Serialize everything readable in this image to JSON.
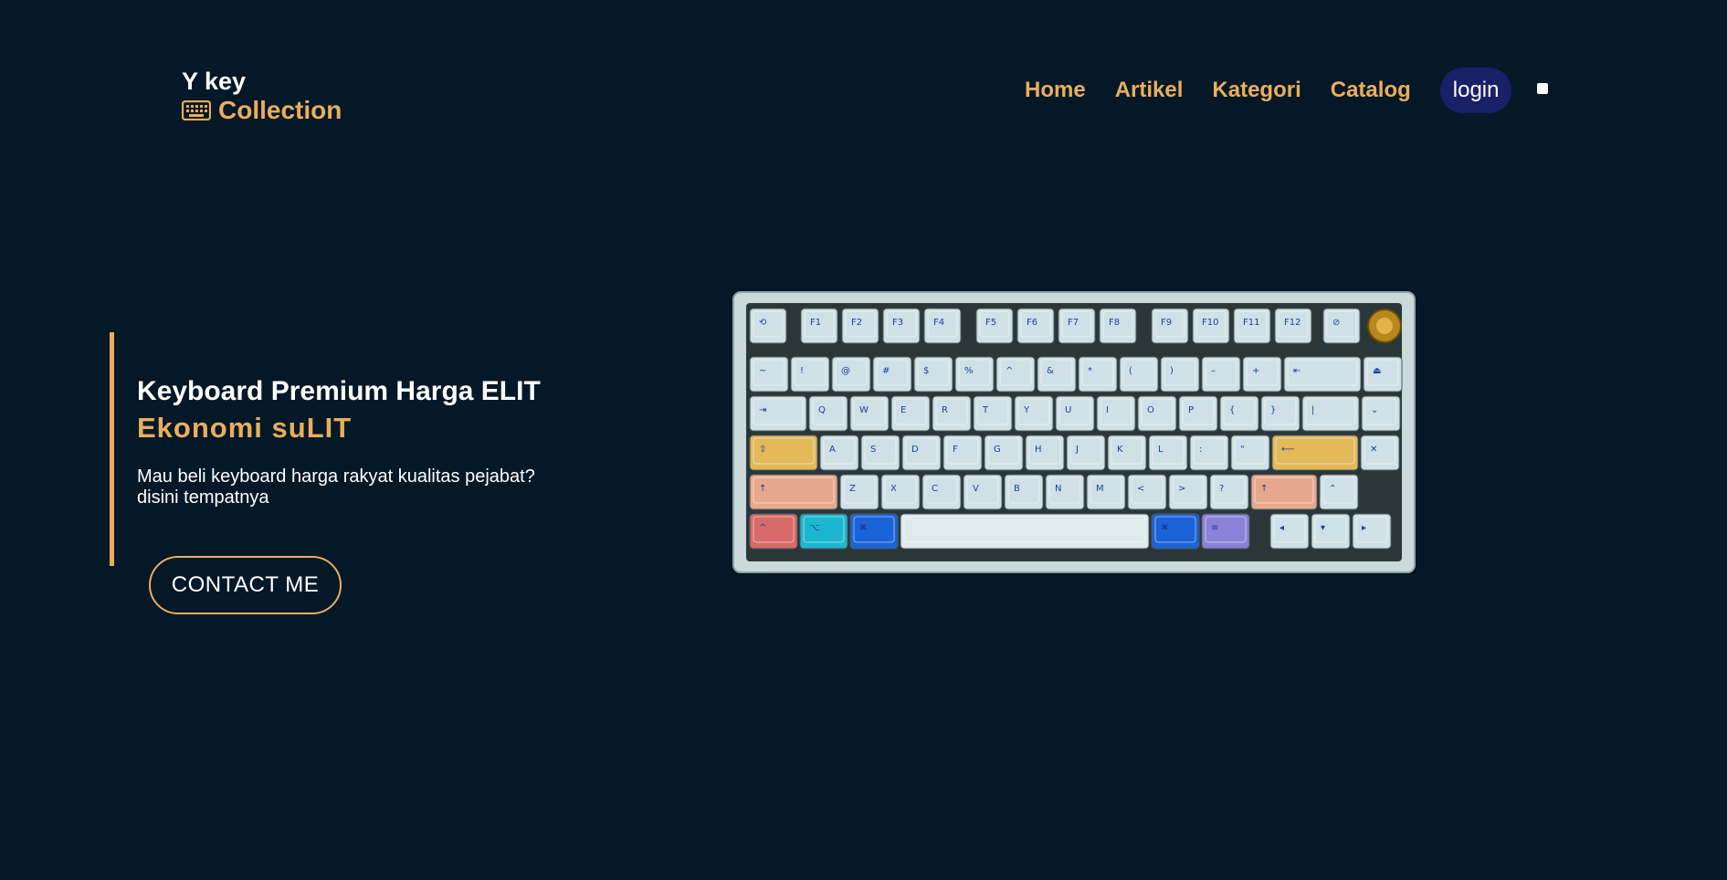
{
  "brand": {
    "line1": "Y key",
    "line2": "Collection",
    "icon": "keyboard-icon"
  },
  "nav": {
    "links": [
      "Home",
      "Artikel",
      "Kategori",
      "Catalog"
    ],
    "login": "login"
  },
  "hero": {
    "title": "Keyboard Premium Harga ELIT",
    "subtitle": "Ekonomi suLIT",
    "description": "Mau beli keyboard harga rakyat kualitas pejabat? disini tempatnya",
    "cta": "CONTACT ME"
  },
  "colors": {
    "background": "#051827",
    "accent": "#e9ae5c",
    "login_bg": "#1a2068",
    "text": "#ffffff"
  },
  "image": {
    "subject": "mechanical-keyboard",
    "keys": {
      "row0": [
        "⟲",
        "F1",
        "F2",
        "F3",
        "F4",
        "F5",
        "F6",
        "F7",
        "F8",
        "F9",
        "F10",
        "F11",
        "F12",
        "⊘"
      ],
      "row1": [
        "~",
        "!",
        "@",
        "#",
        "$",
        "%",
        "^",
        "&",
        "*",
        "(",
        ")",
        "–",
        "+",
        "⇤",
        "⏏"
      ],
      "row2": [
        "⇥",
        "Q",
        "W",
        "E",
        "R",
        "T",
        "Y",
        "U",
        "I",
        "O",
        "P",
        "{",
        "}",
        "|",
        "⌄"
      ],
      "row3": [
        "⇪",
        "A",
        "S",
        "D",
        "F",
        "G",
        "H",
        "J",
        "K",
        "L",
        ":",
        "\"",
        "⟵",
        "✕"
      ],
      "row4": [
        "↑",
        "Z",
        "X",
        "C",
        "V",
        "B",
        "N",
        "M",
        "<",
        ">",
        "?",
        "↑",
        "⌃"
      ],
      "row5": [
        "^",
        "⌥",
        "✖",
        "",
        "✖",
        "≡",
        "◂",
        "▾",
        "▸"
      ]
    }
  }
}
